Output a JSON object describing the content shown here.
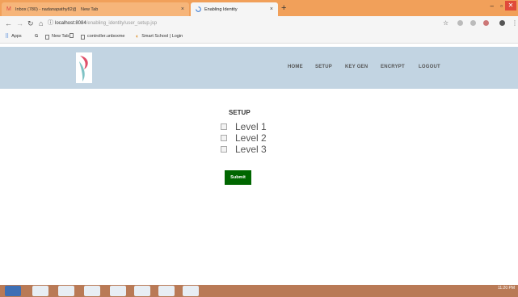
{
  "browser": {
    "tabs": [
      {
        "title": "Inbox (780) - nadanapathy82@g"
      },
      {
        "title": "New Tab"
      },
      {
        "title": "Enabling Identity"
      }
    ],
    "new_tab_symbol": "+",
    "close_symbol": "×",
    "address": {
      "host": "localhost:8084",
      "path": "/enabling_identity/user_setup.jsp"
    },
    "bookmarks": [
      {
        "label": "Apps"
      },
      {
        "label": "G"
      },
      {
        "label": "New Tab"
      },
      {
        "label": "controller.unboxme"
      },
      {
        "label": "Smart School | Login"
      }
    ]
  },
  "site": {
    "nav": [
      {
        "label": "HOME"
      },
      {
        "label": "SETUP"
      },
      {
        "label": "KEY GEN"
      },
      {
        "label": "ENCRYPT"
      },
      {
        "label": "LOGOUT"
      }
    ],
    "colors": {
      "header_bg": "#c2d4e2",
      "submit_bg": "#006600",
      "tab_strip": "#f1a05a",
      "taskbar": "#b97a56"
    }
  },
  "setup": {
    "title": "SETUP",
    "levels": [
      {
        "label": "Level 1",
        "checked": false
      },
      {
        "label": "Level 2",
        "checked": false
      },
      {
        "label": "Level 3",
        "checked": false
      }
    ],
    "submit_label": "Submit"
  },
  "taskbar": {
    "clock": "11:20 PM"
  }
}
